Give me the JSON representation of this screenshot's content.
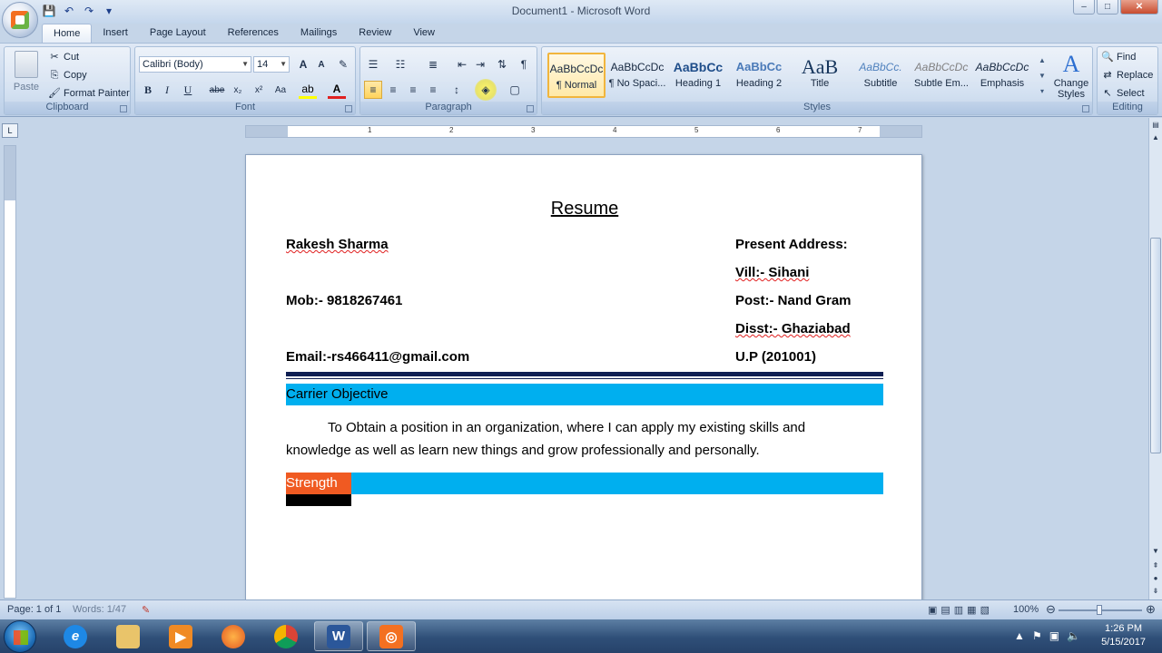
{
  "window": {
    "title": "Document1 - Microsoft Word",
    "minimize": "–",
    "maximize": "□",
    "close": "✕"
  },
  "qat": {
    "save": "💾",
    "undo": "↶",
    "redo": "↷",
    "dropdown": "▾"
  },
  "tabs": [
    "Home",
    "Insert",
    "Page Layout",
    "References",
    "Mailings",
    "Review",
    "View"
  ],
  "clipboard": {
    "paste": "Paste",
    "cut": "Cut",
    "copy": "Copy",
    "format_painter": "Format Painter",
    "label": "Clipboard"
  },
  "font": {
    "name": "Calibri (Body)",
    "size": "14",
    "bold": "B",
    "italic": "I",
    "underline": "U",
    "strike": "abe",
    "subscript": "x₂",
    "superscript": "x²",
    "change_case": "Aa",
    "grow": "A",
    "shrink": "A",
    "label": "Font"
  },
  "paragraph": {
    "label": "Paragraph"
  },
  "styles": {
    "items": [
      {
        "sample": "AaBbCcDc",
        "name": "¶ Normal"
      },
      {
        "sample": "AaBbCcDc",
        "name": "¶ No Spaci..."
      },
      {
        "sample": "AaBbCc",
        "name": "Heading 1"
      },
      {
        "sample": "AaBbCc",
        "name": "Heading 2"
      },
      {
        "sample": "AaB",
        "name": "Title"
      },
      {
        "sample": "AaBbCc.",
        "name": "Subtitle"
      },
      {
        "sample": "AaBbCcDc",
        "name": "Subtle Em..."
      },
      {
        "sample": "AaBbCcDc",
        "name": "Emphasis"
      }
    ],
    "change_styles": "Change Styles",
    "label": "Styles"
  },
  "editing": {
    "find": "Find",
    "replace": "Replace",
    "select": "Select",
    "label": "Editing"
  },
  "ruler": {
    "numbers": [
      "1",
      "2",
      "3",
      "4",
      "5",
      "6",
      "7"
    ]
  },
  "document": {
    "title": "Resume",
    "name": "Rakesh Sharma",
    "mobile": "Mob:- 9818267461",
    "email": "Email:-rs466411@gmail.com",
    "address_heading": "Present Address:",
    "vill": "Vill:- Sihani",
    "post": "Post:- Nand Gram",
    "disst": "Disst:- Ghaziabad",
    "state": "U.P (201001)",
    "objective_heading": "Carrier Objective",
    "objective_text": "To Obtain a position in an organization, where I can apply my existing skills and knowledge as well as learn new things and grow professionally and personally.",
    "strength_heading": "Strength"
  },
  "status": {
    "page": "Page: 1 of 1",
    "words": "Words: 1/47",
    "zoom": "100%"
  },
  "taskbar": {
    "time": "1:26 PM",
    "date": "5/15/2017"
  },
  "colors": {
    "section_bar": "#00afef",
    "strength_highlight": "#f05a22",
    "rule": "#0f1f53"
  }
}
